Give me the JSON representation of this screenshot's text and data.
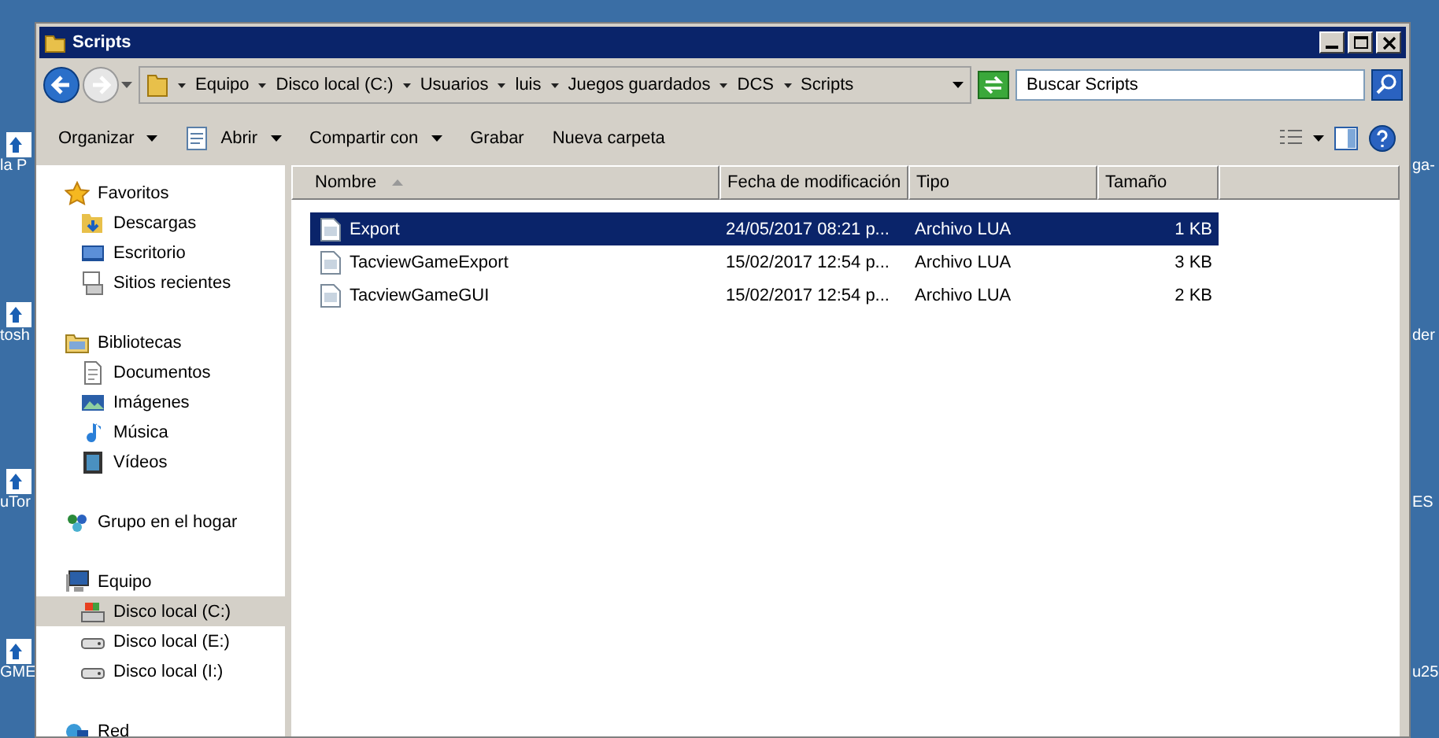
{
  "desktop": {
    "left_labels": [
      "la P",
      "tosh",
      "uTor",
      "GME"
    ],
    "right_labels": [
      "ga-",
      "der",
      "ES",
      "u25"
    ]
  },
  "window": {
    "title": "Scripts"
  },
  "address_bar": {
    "crumbs": [
      "Equipo",
      "Disco local (C:)",
      "Usuarios",
      "luis",
      "Juegos guardados",
      "DCS",
      "Scripts"
    ]
  },
  "search": {
    "placeholder": "Buscar Scripts"
  },
  "toolbar": {
    "items": [
      {
        "label": "Organizar",
        "dropdown": true
      },
      {
        "label": "Abrir",
        "dropdown": true
      },
      {
        "label": "Compartir con",
        "dropdown": true
      },
      {
        "label": "Grabar",
        "dropdown": false
      },
      {
        "label": "Nueva carpeta",
        "dropdown": false
      }
    ]
  },
  "nav_pane": {
    "groups": [
      {
        "label": "Favoritos",
        "children": [
          {
            "label": "Descargas",
            "selected": false
          },
          {
            "label": "Escritorio",
            "selected": false
          },
          {
            "label": "Sitios recientes",
            "selected": false
          }
        ]
      },
      {
        "label": "Bibliotecas",
        "children": [
          {
            "label": "Documentos",
            "selected": false
          },
          {
            "label": "Imágenes",
            "selected": false
          },
          {
            "label": "Música",
            "selected": false
          },
          {
            "label": "Vídeos",
            "selected": false
          }
        ]
      },
      {
        "label": "Grupo en el hogar"
      },
      {
        "label": "Equipo",
        "children": [
          {
            "label": "Disco local (C:)",
            "selected": true
          },
          {
            "label": "Disco local (E:)",
            "selected": false
          },
          {
            "label": "Disco local (I:)",
            "selected": false
          }
        ]
      },
      {
        "label": "Red"
      }
    ]
  },
  "file_list": {
    "columns": [
      {
        "label": "Nombre",
        "sorted": true
      },
      {
        "label": "Fecha de modificación",
        "sorted": false
      },
      {
        "label": "Tipo",
        "sorted": false
      },
      {
        "label": "Tamaño",
        "sorted": false
      }
    ],
    "rows": [
      {
        "name": "Export",
        "date": "24/05/2017 08:21 p...",
        "type": "Archivo LUA",
        "size": "1 KB",
        "selected": true
      },
      {
        "name": "TacviewGameExport",
        "date": "15/02/2017 12:54 p...",
        "type": "Archivo LUA",
        "size": "3 KB",
        "selected": false
      },
      {
        "name": "TacviewGameGUI",
        "date": "15/02/2017 12:54 p...",
        "type": "Archivo LUA",
        "size": "2 KB",
        "selected": false
      }
    ]
  }
}
